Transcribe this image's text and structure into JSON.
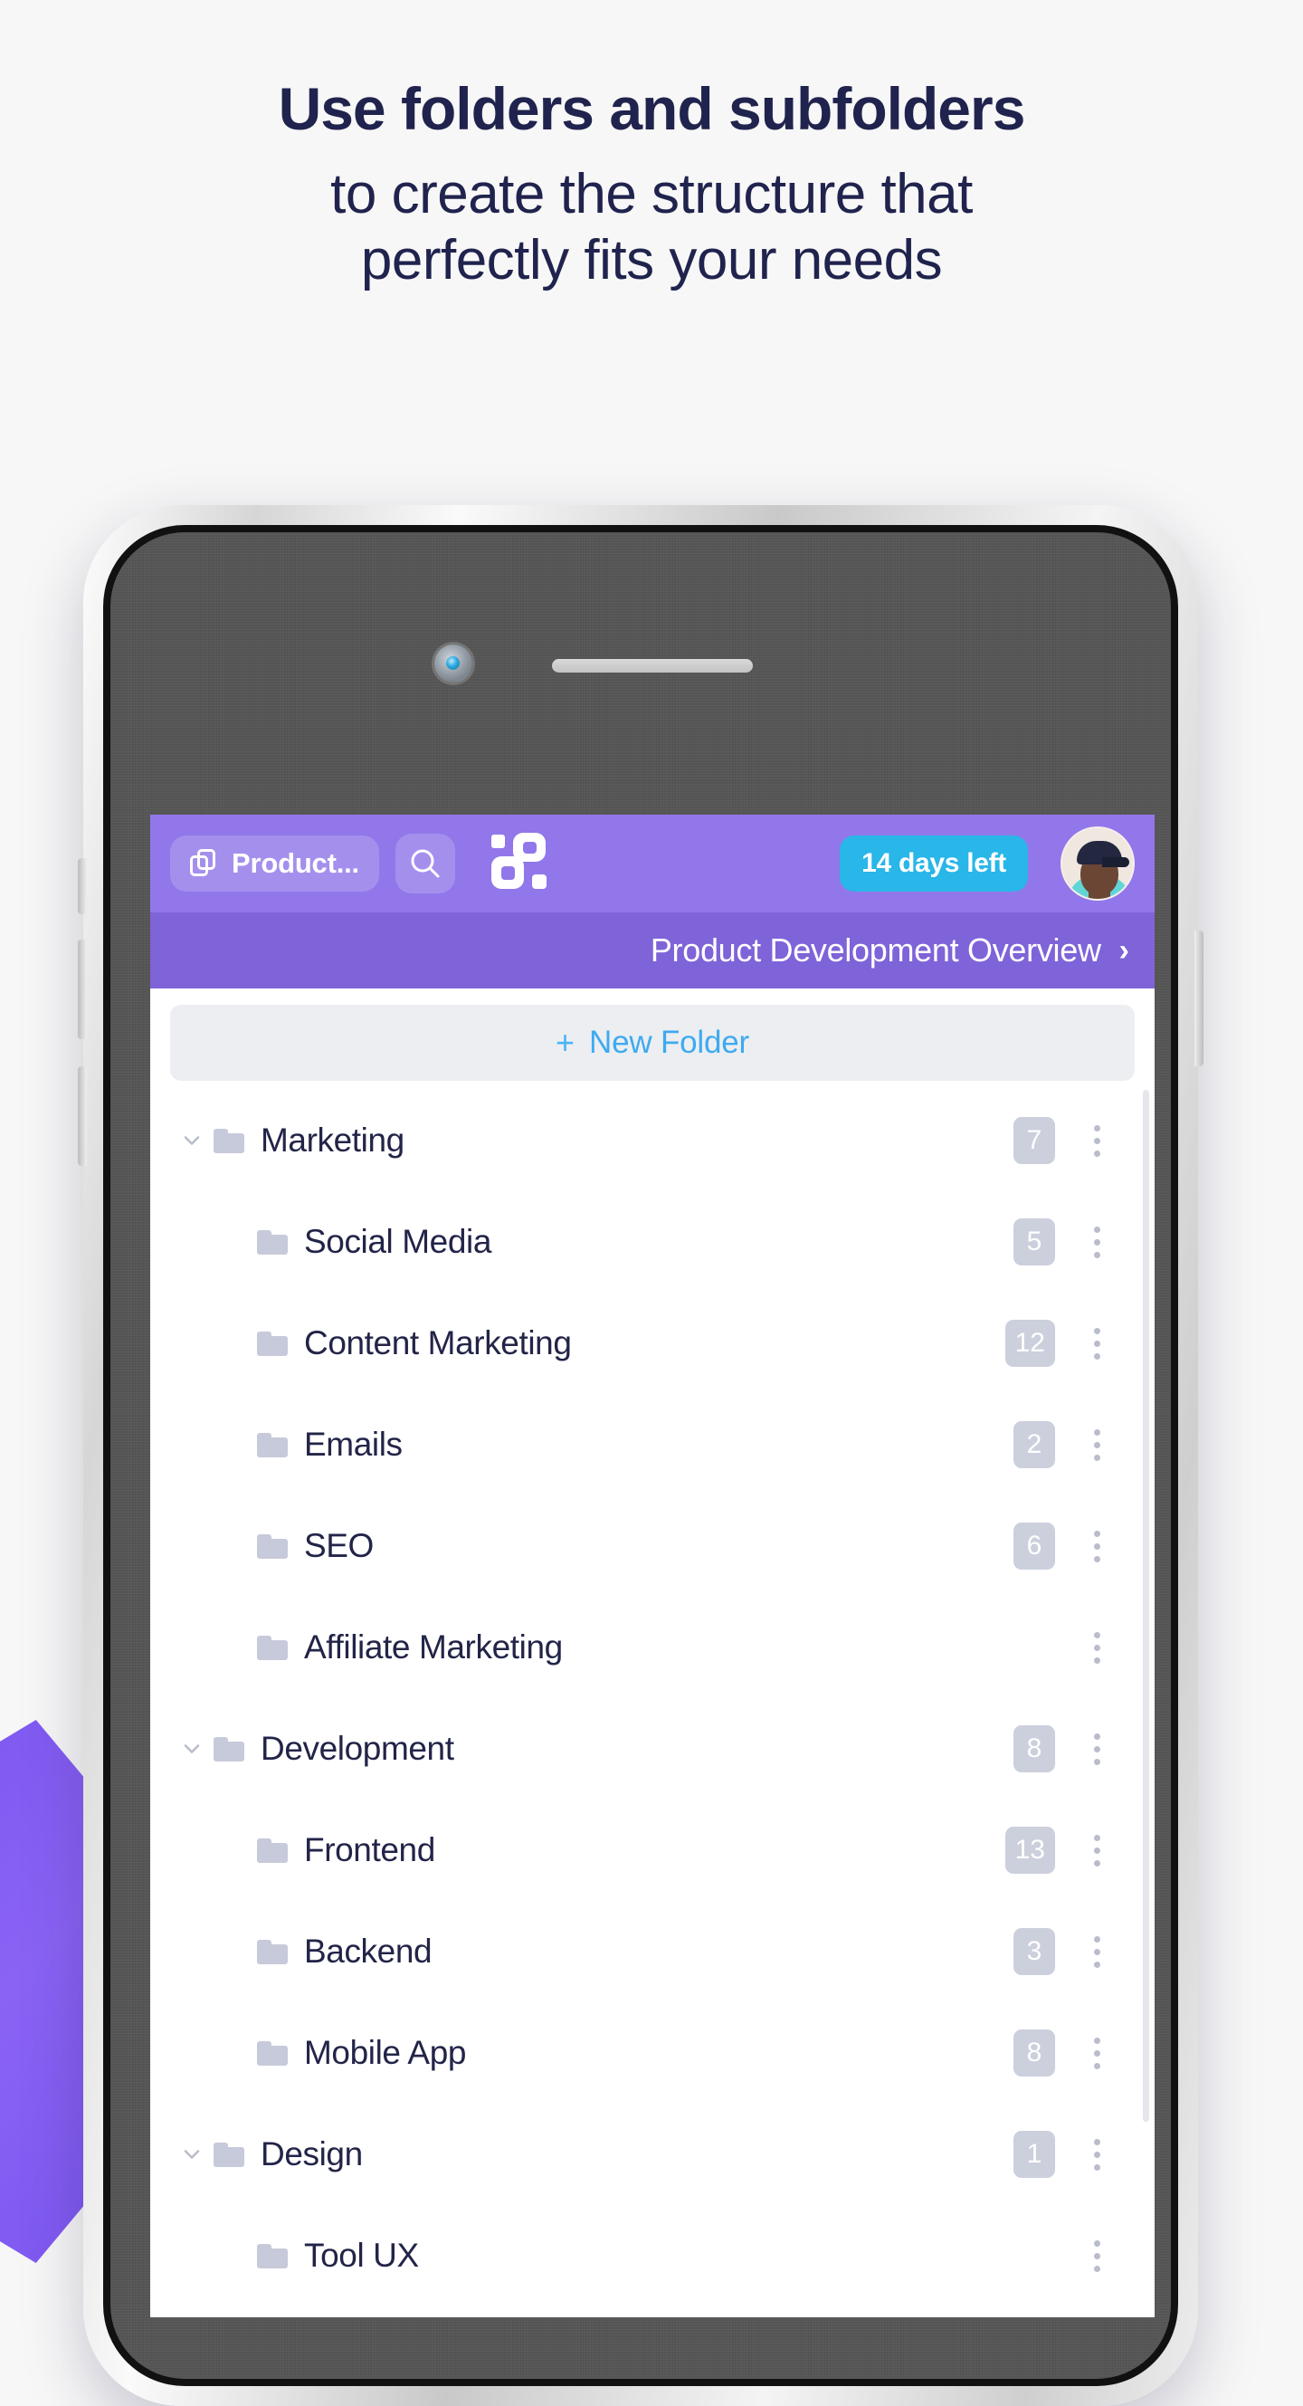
{
  "headline": {
    "line1": "Use folders and subfolders",
    "line2": "to create the structure that",
    "line3": "perfectly fits your needs"
  },
  "colors": {
    "headline_text": "#20234d",
    "page_background": "#f7f7f7",
    "header_purple": "#9277ea",
    "breadcrumb_purple": "#7f63d8",
    "trial_badge": "#29b6e8",
    "accent_blue": "#3eaaf0",
    "badge_grey": "#ccd0dd",
    "deco_purple": "#7b55f0"
  },
  "app": {
    "header": {
      "workspace_chip_label": "Product...",
      "workspace_chip_icon": "copy-icon",
      "search_icon": "search-icon",
      "brand_logo": "brand-logo-icon",
      "trial_badge_label": "14 days left",
      "avatar": "user-avatar"
    },
    "breadcrumb": {
      "label": "Product Development Overview",
      "chevron": "chevron-right-icon"
    },
    "new_folder": {
      "plus": "+",
      "label": "New Folder"
    },
    "folder_rows": [
      {
        "label": "Marketing",
        "count": "7",
        "level": "parent",
        "expanded": true,
        "menu": "kebab-menu-icon"
      },
      {
        "label": "Social Media",
        "count": "5",
        "level": "child",
        "expanded": false,
        "menu": "kebab-menu-icon"
      },
      {
        "label": "Content Marketing",
        "count": "12",
        "level": "child",
        "expanded": false,
        "menu": "kebab-menu-icon"
      },
      {
        "label": "Emails",
        "count": "2",
        "level": "child",
        "expanded": false,
        "menu": "kebab-menu-icon"
      },
      {
        "label": "SEO",
        "count": "6",
        "level": "child",
        "expanded": false,
        "menu": "kebab-menu-icon"
      },
      {
        "label": "Affiliate Marketing",
        "count": "",
        "level": "child",
        "expanded": false,
        "menu": "kebab-menu-icon"
      },
      {
        "label": "Development",
        "count": "8",
        "level": "parent",
        "expanded": true,
        "menu": "kebab-menu-icon"
      },
      {
        "label": "Frontend",
        "count": "13",
        "level": "child",
        "expanded": false,
        "menu": "kebab-menu-icon"
      },
      {
        "label": "Backend",
        "count": "3",
        "level": "child",
        "expanded": false,
        "menu": "kebab-menu-icon"
      },
      {
        "label": "Mobile App",
        "count": "8",
        "level": "child",
        "expanded": false,
        "menu": "kebab-menu-icon"
      },
      {
        "label": "Design",
        "count": "1",
        "level": "parent",
        "expanded": true,
        "menu": "kebab-menu-icon"
      },
      {
        "label": "Tool UX",
        "count": "",
        "level": "child",
        "expanded": false,
        "menu": "kebab-menu-icon"
      }
    ]
  },
  "device": {
    "camera": "front-camera",
    "speaker": "earpiece-speaker"
  }
}
